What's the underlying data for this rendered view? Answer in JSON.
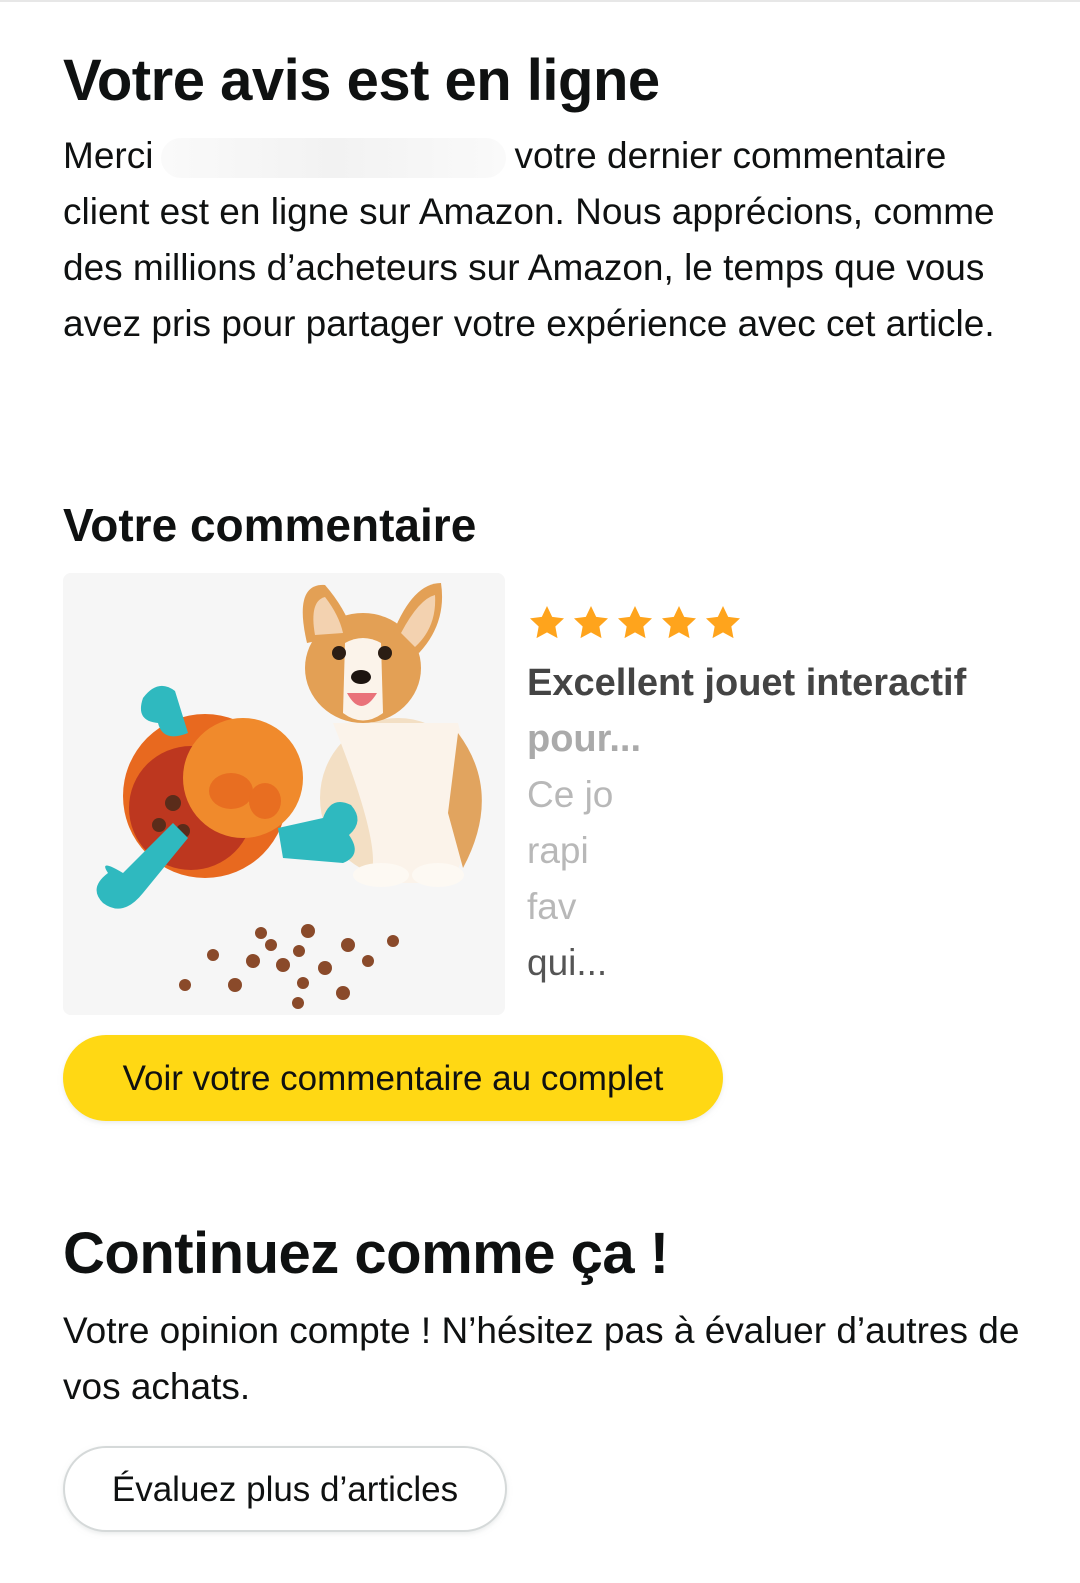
{
  "colors": {
    "accent_yellow": "#FFD814",
    "star_orange": "#FFA41C",
    "text": "#0F1111",
    "border": "#D5D9D9"
  },
  "confirmation": {
    "title": "Votre avis est en ligne",
    "text_before_name": "Merci",
    "text_after_name": "votre dernier commentaire client est en ligne sur Amazon. Nous apprécions, comme des millions d’acheteurs sur Amazon, le temps que vous avez pris pour partager votre expérience avec cet article."
  },
  "review_section": {
    "heading": "Votre commentaire",
    "product_image_icon": "dog-treat-toy-image",
    "rating": 5,
    "rating_max": 5,
    "review_title_line1": "Excellent jouet interactif",
    "review_title_line2": "pour...",
    "review_body_lines": [
      "Ce jo",
      "rapi",
      "fav",
      "qui..."
    ],
    "button_label": "Voir votre commentaire au complet"
  },
  "encouragement": {
    "title": "Continuez comme ça !",
    "text": "Votre opinion compte ! N’hésitez pas à évaluer d’autres de vos achats.",
    "button_label": "Évaluez plus d’articles"
  }
}
